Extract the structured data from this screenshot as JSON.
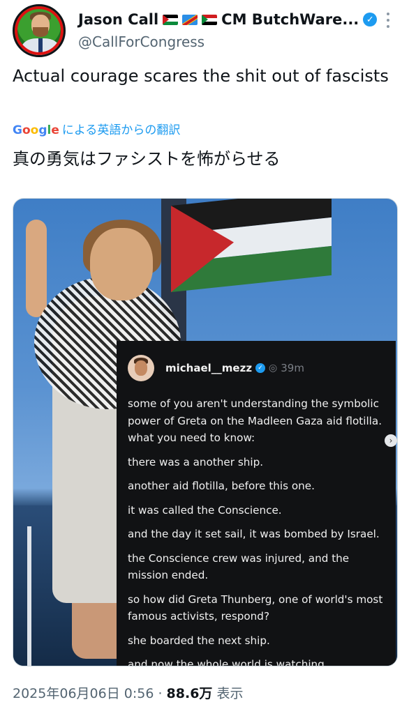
{
  "tweet": {
    "display_name": "Jason Call",
    "name_suffix": "CM ButchWare...",
    "flags": [
      "palestine-flag",
      "dr-congo-flag",
      "sudan-flag"
    ],
    "handle": "@CallForCongress",
    "verified": true,
    "text": "Actual courage scares the shit out of fascists",
    "translate_brand": "Google",
    "translate_label": "による英語からの翻訳",
    "translated_text": "真の勇気はファシストを怖がらせる"
  },
  "embedded_post": {
    "username": "michael__mezz",
    "time": "39m",
    "lines": [
      "some of you aren't understanding the symbolic power of Greta on the Madleen Gaza aid flotilla. what you need to know:",
      "there was a another ship.",
      "another aid flotilla, before this one.",
      "it was called the Conscience.",
      "and the day it set sail, it was bombed by Israel.",
      "the Conscience crew was injured, and the mission ended.",
      "so how did Greta Thunberg, one of world's most famous activists, respond?",
      "she boarded the next ship.",
      "and now the whole world is watching."
    ]
  },
  "footer": {
    "timestamp": "2025年06月06日 0:56 · ",
    "views": "88.6万",
    "views_label": " 表示"
  },
  "colors": {
    "accent": "#1d9bf0",
    "text_primary": "#0f1419",
    "text_secondary": "#536471"
  }
}
